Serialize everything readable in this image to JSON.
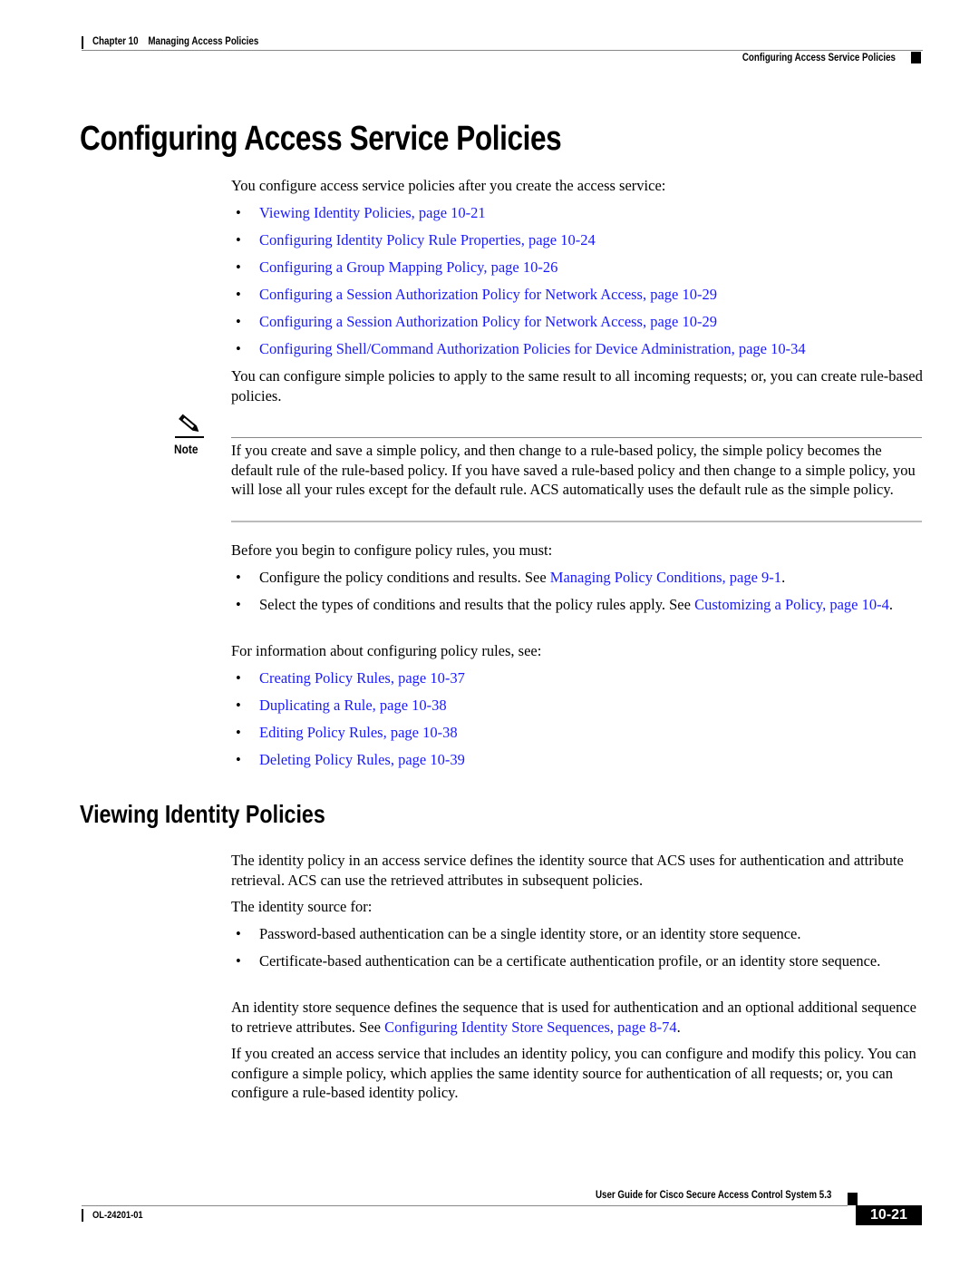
{
  "header": {
    "chapter_label": "Chapter 10",
    "chapter_title": "Managing Access Policies",
    "section_title": "Configuring Access Service Policies"
  },
  "section1": {
    "title": "Configuring Access Service Policies",
    "intro": "You configure access service policies after you create the access service:",
    "links": [
      "Viewing Identity Policies, page 10-21",
      "Configuring Identity Policy Rule Properties, page 10-24",
      "Configuring a Group Mapping Policy, page 10-26",
      "Configuring a Session Authorization Policy for Network Access, page 10-29",
      "Configuring a Session Authorization Policy for Network Access, page 10-29",
      "Configuring Shell/Command Authorization Policies for Device Administration, page 10-34"
    ],
    "para2": "You can configure simple policies to apply to the same result to all incoming requests; or, you can create rule-based policies.",
    "note": {
      "label": "Note",
      "icon": "pencil-icon",
      "text": "If you create and save a simple policy, and then change to a rule-based policy, the simple policy becomes the default rule of the rule-based policy. If you have saved a rule-based policy and then change to a simple policy, you will lose all your rules except for the default rule. ACS automatically uses the default rule as the simple policy."
    },
    "before_intro": "Before you begin to configure policy rules, you must:",
    "prereqs": [
      {
        "text": "Configure the policy conditions and results. See ",
        "link": "Managing Policy Conditions, page 9-1",
        "after": "."
      },
      {
        "text": "Select the types of conditions and results that the policy rules apply. See ",
        "link": "Customizing a Policy, page 10-4",
        "after": "."
      }
    ],
    "info_intro": "For information about configuring policy rules, see:",
    "rule_links": [
      "Creating Policy Rules, page 10-37",
      "Duplicating a Rule, page 10-38",
      "Editing Policy Rules, page 10-38",
      "Deleting Policy Rules, page 10-39"
    ]
  },
  "section2": {
    "title": "Viewing Identity Policies",
    "para1": "The identity policy in an access service defines the identity source that ACS uses for authentication and attribute retrieval. ACS can use the retrieved attributes in subsequent policies.",
    "para2": "The identity source for:",
    "bullets": [
      "Password-based authentication can be a single identity store, or an identity store sequence.",
      "Certificate-based authentication can be a certificate authentication profile, or an identity store sequence."
    ],
    "para3_text": "An identity store sequence defines the sequence that is used for authentication and an optional additional sequence to retrieve attributes. See ",
    "para3_link": "Configuring Identity Store Sequences, page 8-74",
    "para3_after": ".",
    "para4": "If you created an access service that includes an identity policy, you can configure and modify this policy. You can configure a simple policy, which applies the same identity source for authentication of all requests; or, you can configure a rule-based identity policy."
  },
  "footer": {
    "guide_title": "User Guide for Cisco Secure Access Control System 5.3",
    "doc_number": "OL-24201-01",
    "page_number": "10-21"
  },
  "bullet_char": "•"
}
